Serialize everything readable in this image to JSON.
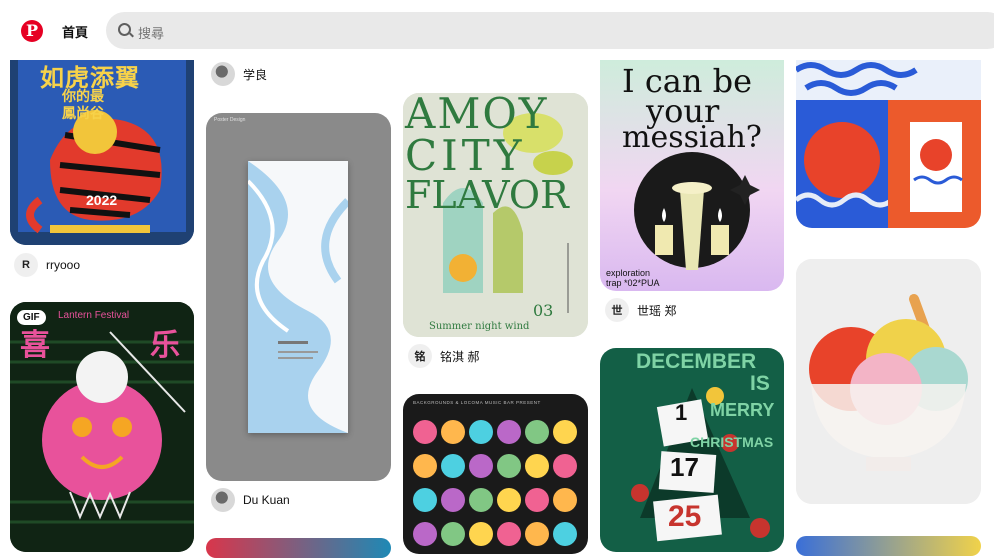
{
  "header": {
    "logo_letter": "P",
    "home_label": "首頁",
    "search_placeholder": "搜尋"
  },
  "pins": {
    "tiger": {
      "title": "如虎添翼",
      "sub": "你的最\n鳳尚谷",
      "year": "2022"
    },
    "lantern": {
      "title": "Lantern Festival",
      "gif_label": "GIF",
      "char_left": "喜",
      "char_right": "乐"
    },
    "marble": {
      "header": "Poster Design"
    },
    "amoy": {
      "line1": "AMOY",
      "line2": "CITY",
      "line3": "FLAVOR",
      "number": "03",
      "caption": "Summer night wind"
    },
    "dots": {
      "header": "BACKGROUNDS & LOCOMA MUSIC BAR PRESENT"
    },
    "messiah": {
      "line1": "I can be",
      "line2": "your",
      "line3": "messiah?",
      "caption": "exploration\ntrap *02*PUA"
    },
    "december": {
      "line1": "DECEMBER",
      "line2": "IS",
      "line3": "MERRY",
      "line4": "CHRISTMAS",
      "n1": "1",
      "n2": "17",
      "n3": "25"
    }
  },
  "users": {
    "top2": "学良",
    "rryooo": "rryooo",
    "rryooo_initial": "R",
    "du_kuan": "Du Kuan",
    "mingqi": "铭淇 郝",
    "mingqi_initial": "铭",
    "shiyao": "世瑶 郑",
    "shiyao_initial": "世"
  },
  "colors": {
    "brand": "#e60023",
    "search_bg": "#e9e9e9"
  }
}
